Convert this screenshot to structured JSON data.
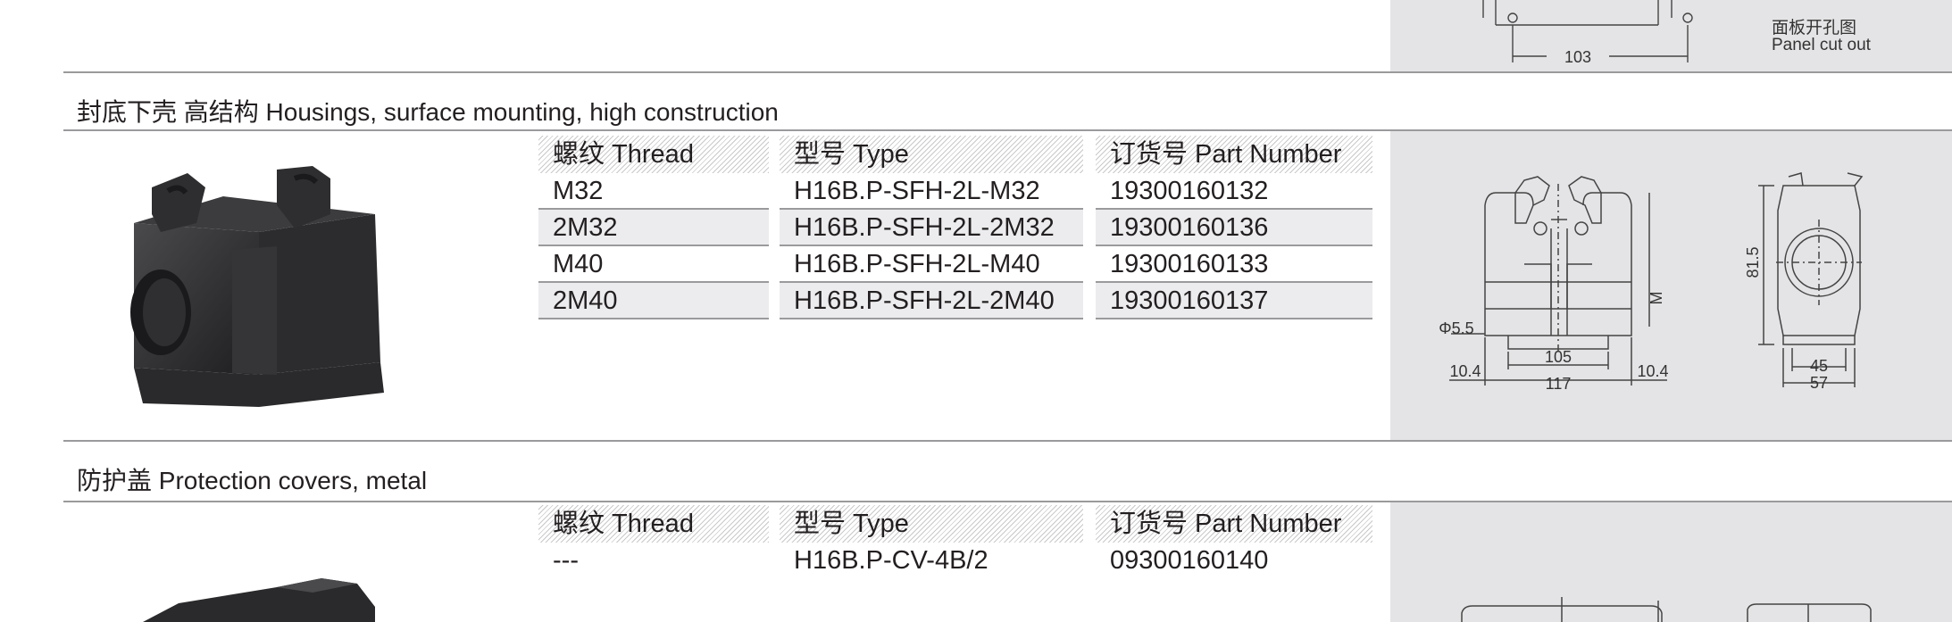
{
  "top": {
    "cutout_dim": "103",
    "cutout_label_cn": "面板开孔图",
    "cutout_label_en": "Panel cut out"
  },
  "sections": [
    {
      "title": "封底下壳 高结构 Housings, surface mounting, high construction",
      "headers": {
        "thread": "螺纹 Thread",
        "type": "型号 Type",
        "part": "订货号 Part Number"
      },
      "rows": [
        {
          "thread": "M32",
          "type": "H16B.P-SFH-2L-M32",
          "part": "19300160132"
        },
        {
          "thread": "2M32",
          "type": "H16B.P-SFH-2L-2M32",
          "part": "19300160136"
        },
        {
          "thread": "M40",
          "type": "H16B.P-SFH-2L-M40",
          "part": "19300160133"
        },
        {
          "thread": "2M40",
          "type": "H16B.P-SFH-2L-2M40",
          "part": "19300160137"
        }
      ],
      "drawing": {
        "hole": "Φ5.5",
        "left_margin": "10.4",
        "inner_width": "105",
        "outer_width": "117",
        "right_margin": "10.4",
        "thread_label": "M",
        "height": "81.5",
        "side_inner": "45",
        "side_outer": "57"
      }
    },
    {
      "title": "防护盖 Protection covers, metal",
      "headers": {
        "thread": "螺纹 Thread",
        "type": "型号 Type",
        "part": "订货号 Part Number"
      },
      "rows": [
        {
          "thread": "---",
          "type": "H16B.P-CV-4B/2",
          "part": "09300160140"
        }
      ]
    }
  ]
}
